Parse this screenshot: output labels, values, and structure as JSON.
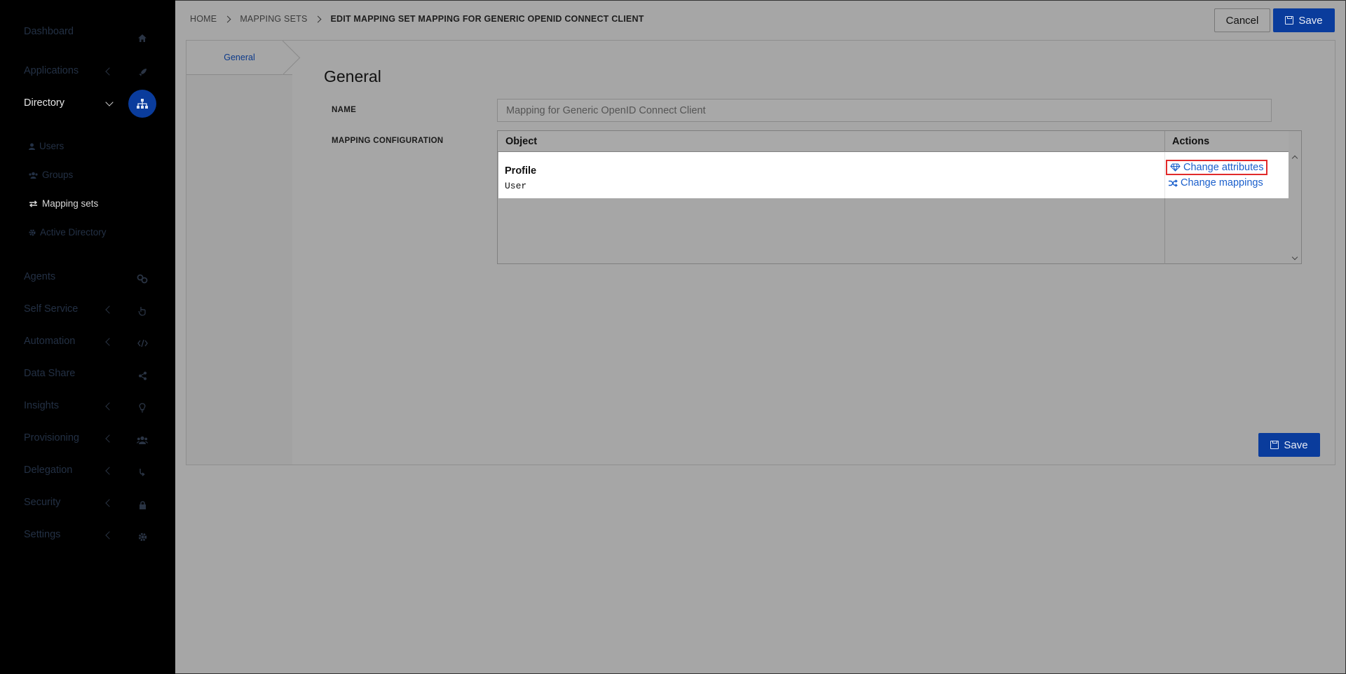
{
  "sidebar": {
    "items": [
      {
        "label": "Dashboard",
        "icon": "home-icon"
      },
      {
        "label": "Applications",
        "icon": "rocket-icon"
      },
      {
        "label": "Directory",
        "icon": "sitemap-icon"
      },
      {
        "label": "Agents",
        "icon": "agents-icon"
      },
      {
        "label": "Self Service",
        "icon": "hand-icon"
      },
      {
        "label": "Automation",
        "icon": "code-icon"
      },
      {
        "label": "Data Share",
        "icon": "share-icon"
      },
      {
        "label": "Insights",
        "icon": "lightbulb-icon"
      },
      {
        "label": "Provisioning",
        "icon": "users-icon"
      },
      {
        "label": "Delegation",
        "icon": "delegation-icon"
      },
      {
        "label": "Security",
        "icon": "lock-icon"
      },
      {
        "label": "Settings",
        "icon": "gear-icon"
      }
    ],
    "sub_items": [
      {
        "label": "Users",
        "icon": "user-icon"
      },
      {
        "label": "Groups",
        "icon": "group-icon"
      },
      {
        "label": "Mapping sets",
        "icon": "exchange-icon"
      },
      {
        "label": "Active Directory",
        "icon": "gear-icon"
      }
    ]
  },
  "breadcrumb": {
    "home": "HOME",
    "mapping_sets": "MAPPING SETS",
    "current": "EDIT MAPPING SET MAPPING FOR GENERIC OPENID CONNECT CLIENT"
  },
  "toolbar": {
    "cancel_label": "Cancel",
    "save_label": "Save"
  },
  "tabs": {
    "general": "General"
  },
  "form": {
    "section_title": "General",
    "name_label": "NAME",
    "name_value": "Mapping for Generic OpenID Connect Client",
    "mapping_label": "MAPPING CONFIGURATION"
  },
  "grid": {
    "columns": [
      "Object",
      "Actions"
    ],
    "rows": [
      {
        "title": "Profile",
        "subtitle": "User",
        "actions": [
          "Change attributes",
          "Change mappings"
        ]
      }
    ]
  },
  "footer": {
    "save_label": "Save"
  },
  "colors": {
    "primary": "#0a3c9c",
    "link": "#1a5fcc",
    "highlight": "#e12a2a"
  }
}
